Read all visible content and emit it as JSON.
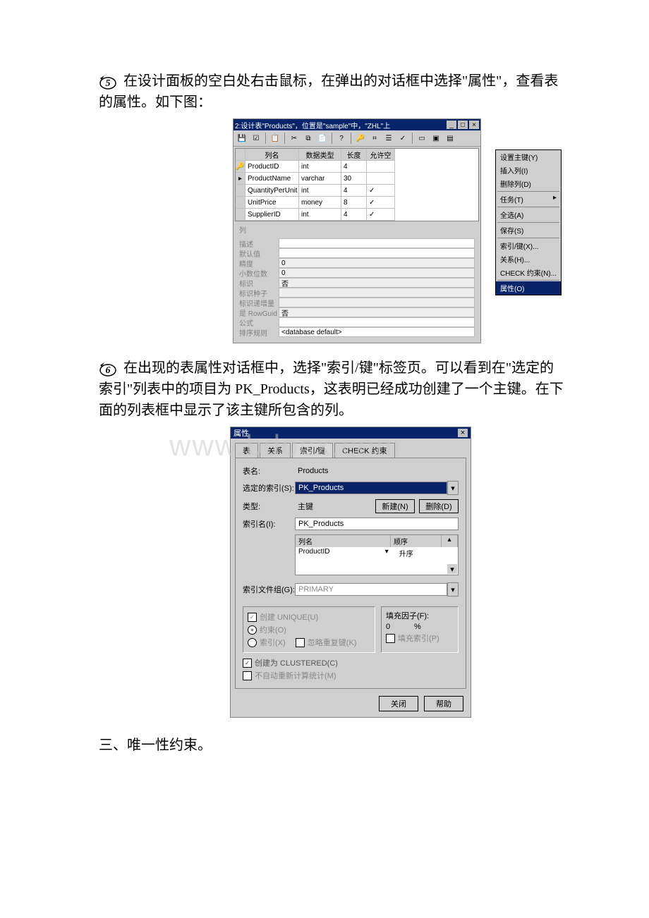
{
  "step5": {
    "text": "在设计面板的空白处右击鼠标，在弹出的对话框中选择\"属性\"，查看表的属性。如下图："
  },
  "step6": {
    "text": "在出现的表属性对话框中，选择\"索引/键\"标签页。可以看到在\"选定的索引\"列表中的项目为 PK_Products，这表明已经成功创建了一个主键。在下面的列表框中显示了该主键所包含的列。"
  },
  "section3": "三、唯一性约束。",
  "watermark": "www.bdocx.com",
  "designer": {
    "title": "2:设计表\"Products\"，位置是\"sample\"中，\"ZHL\"上",
    "columns_header": {
      "name": "列名",
      "type": "数据类型",
      "len": "长度",
      "null": "允许空"
    },
    "rows": [
      {
        "name": "ProductID",
        "type": "int",
        "len": "4",
        "null": ""
      },
      {
        "name": "ProductName",
        "type": "varchar",
        "len": "30",
        "null": ""
      },
      {
        "name": "QuantityPerUnit",
        "type": "int",
        "len": "4",
        "null": "✓"
      },
      {
        "name": "UnitPrice",
        "type": "money",
        "len": "8",
        "null": "✓"
      },
      {
        "name": "SupplierID",
        "type": "int",
        "len": "4",
        "null": "✓"
      }
    ],
    "ctx": {
      "set_pk": "设置主键(Y)",
      "insert_col": "插入列(I)",
      "delete_col": "删除列(D)",
      "task": "任务(T)",
      "select_all": "全选(A)",
      "save": "保存(S)",
      "indexes": "索引/键(X)...",
      "relations": "关系(H)...",
      "check": "CHECK 约束(N)...",
      "props": "属性(O)"
    },
    "props_panel": {
      "col_label": "列",
      "desc": "描述",
      "default": "默认值",
      "precision": "精度",
      "precision_v": "0",
      "scale": "小数位数",
      "scale_v": "0",
      "identity": "标识",
      "identity_v": "否",
      "seed": "标识种子",
      "incr": "标识递增量",
      "rowguid": "是 RowGuid",
      "rowguid_v": "否",
      "formula": "公式",
      "collation": "排序规则",
      "collation_v": "<database default>"
    }
  },
  "dialog": {
    "title": "属性",
    "tabs": {
      "table": "表",
      "rel": "关系",
      "idx": "索引/键",
      "check": "CHECK 约束"
    },
    "table_label": "表名:",
    "table_value": "Products",
    "sel_label": "选定的索引(S):",
    "sel_value": "PK_Products",
    "type_label": "类型:",
    "type_value": "主键",
    "new_btn": "新建(N)",
    "del_btn": "删除(D)",
    "idxname_label": "索引名(I):",
    "idxname_value": "PK_Products",
    "cols": {
      "name_h": "列名",
      "order_h": "顺序",
      "name": "ProductID",
      "order": "升序"
    },
    "filegroup_label": "索引文件组(G):",
    "filegroup_value": "PRIMARY",
    "unique_label": " 创建 UNIQUE(U)",
    "constraint_label": " 约束(O)",
    "index_label": " 索引(X)",
    "ignore_dup": " 忽略重复键(K)",
    "fill_label": "填充因子(F):",
    "fill_value": "0",
    "fill_pct": "%",
    "pad_label": " 填充索引(P)",
    "clustered": " 创建为 CLUSTERED(C)",
    "norecompute": " 不自动重新计算统计(M)",
    "close": "关闭",
    "help": "帮助"
  }
}
